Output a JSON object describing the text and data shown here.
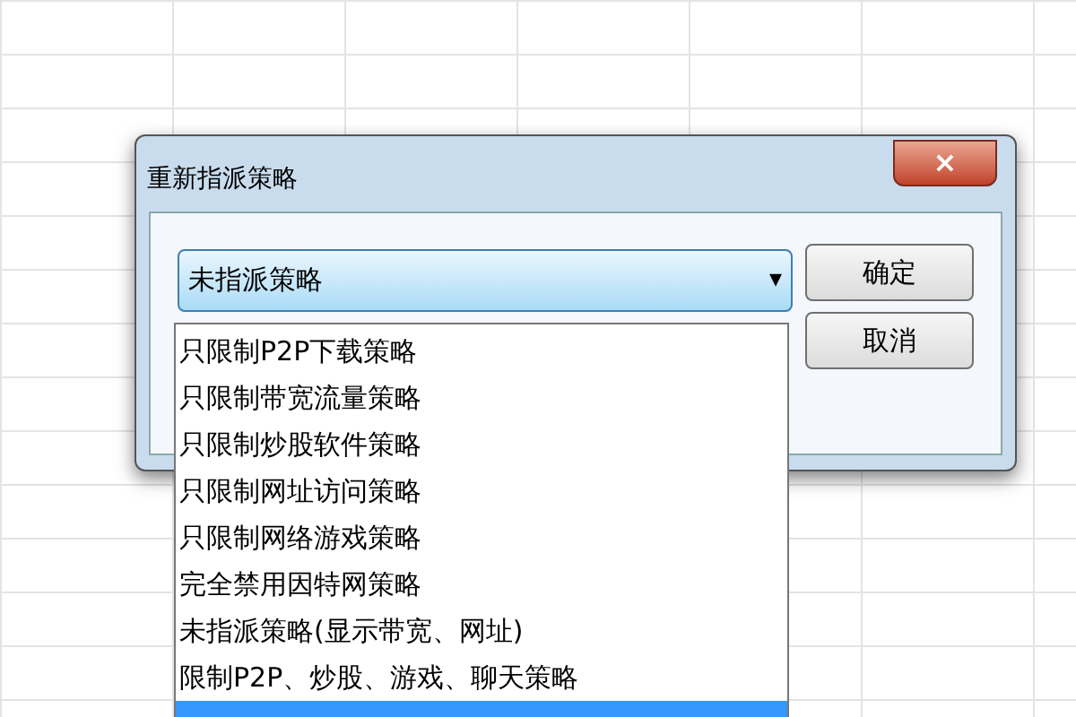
{
  "dialog": {
    "title": "重新指派策略",
    "close": "×",
    "combo": {
      "value": "未指派策略",
      "arrow": "▾"
    },
    "buttons": [
      "确定",
      "取消"
    ],
    "list": [
      {
        "label": "只限制P2P下载策略",
        "selected": false
      },
      {
        "label": "只限制带宽流量策略",
        "selected": false
      },
      {
        "label": "只限制炒股软件策略",
        "selected": false
      },
      {
        "label": "只限制网址访问策略",
        "selected": false
      },
      {
        "label": "只限制网络游戏策略",
        "selected": false
      },
      {
        "label": "完全禁用因特网策略",
        "selected": false
      },
      {
        "label": "未指派策略(显示带宽、网址)",
        "selected": false
      },
      {
        "label": "限制P2P、炒股、游戏、聊天策略",
        "selected": false
      },
      {
        "selected": true
      }
    ]
  }
}
